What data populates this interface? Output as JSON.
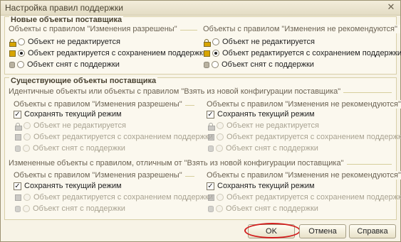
{
  "window": {
    "title": "Настройка правил поддержки"
  },
  "new_objects": {
    "title": "Новые объекты поставщика",
    "left": {
      "label": "Объекты с правилом \"Изменения разрешены\"",
      "options": [
        "Объект не редактируется",
        "Объект редактируется с сохранением поддержки",
        "Объект снят с поддержки"
      ]
    },
    "right": {
      "label": "Объекты с правилом \"Изменения не рекомендуются\"",
      "options": [
        "Объект не редактируется",
        "Объект редактируется с сохранением поддержки",
        "Объект снят с поддержки"
      ]
    }
  },
  "existing_objects": {
    "title": "Существующие объекты поставщика",
    "identical": {
      "label": "Идентичные объекты или объекты с правилом \"Взять из новой конфигурации поставщика\"",
      "left": {
        "label": "Объекты с правилом \"Изменения разрешены\"",
        "keep_mode": "Сохранять текущий режим",
        "options": [
          "Объект не редактируется",
          "Объект редактируется с сохранением поддержки",
          "Объект снят с поддержки"
        ]
      },
      "right": {
        "label": "Объекты с правилом \"Изменения не рекомендуются\"",
        "keep_mode": "Сохранять текущий режим",
        "options": [
          "Объект не редактируется",
          "Объект редактируется с сохранением поддержки",
          "Объект снят с поддержки"
        ]
      }
    },
    "changed": {
      "label": "Измененные объекты с правилом, отличным от \"Взять из новой конфигурации поставщика\"",
      "left": {
        "label": "Объекты с правилом \"Изменения разрешены\"",
        "keep_mode": "Сохранять текущий режим",
        "options": [
          "Объект редактируется с сохранением поддержки",
          "Объект снят с поддержки"
        ]
      },
      "right": {
        "label": "Объекты с правилом \"Изменения не рекомендуются\"",
        "keep_mode": "Сохранять текущий режим",
        "options": [
          "Объект редактируется с сохранением поддержки",
          "Объект снят с поддержки"
        ]
      }
    }
  },
  "buttons": {
    "ok": "OK",
    "cancel": "Отмена",
    "help": "Справка"
  },
  "icons": {
    "close": "close-icon",
    "lock": "lock-icon",
    "cube": "cube-icon",
    "cylinder": "cylinder-icon"
  }
}
